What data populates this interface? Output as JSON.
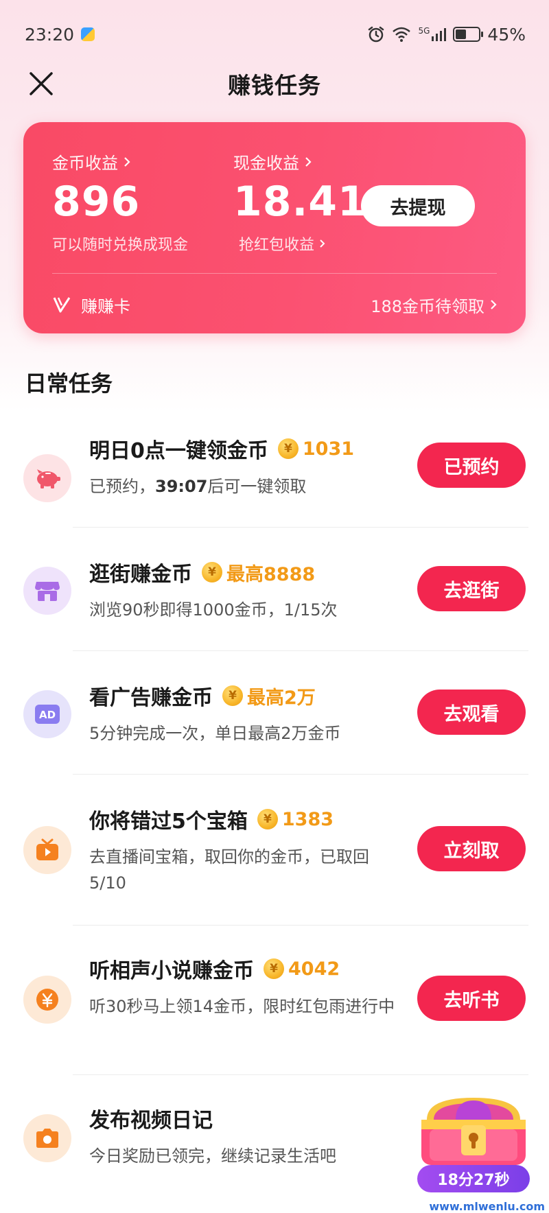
{
  "status_bar": {
    "time": "23:20",
    "network": "5G",
    "battery_percent": "45%",
    "battery_level": 0.45
  },
  "header": {
    "title": "赚钱任务",
    "close_icon": "close-icon"
  },
  "earnings": {
    "coin_label": "金币收益",
    "coin_value": "896",
    "coin_sub": "可以随时兑换成现金",
    "cash_label": "现金收益",
    "cash_value": "18.41",
    "cash_sub": "抢红包收益",
    "withdraw_label": "去提现",
    "card_name": "赚赚卡",
    "card_pending": "188金币待领取",
    "colors": {
      "card_start": "#f94a65",
      "card_end": "#fd5a82"
    }
  },
  "daily": {
    "section_title": "日常任务",
    "tasks": [
      {
        "icon": "piggy-bank-icon",
        "title": "明日0点一键领金币",
        "reward": "1031",
        "desc_prefix": "已预约，",
        "desc_bold": "39:07",
        "desc_suffix": "后可一键领取",
        "button": "已预约"
      },
      {
        "icon": "shop-icon",
        "title": "逛街赚金币",
        "reward": "最高8888",
        "desc": "浏览90秒即得1000金币，1/15次",
        "button": "去逛街"
      },
      {
        "icon": "ad-icon",
        "title": "看广告赚金币",
        "reward": "最高2万",
        "desc": "5分钟完成一次，单日最高2万金币",
        "button": "去观看"
      },
      {
        "icon": "tv-play-icon",
        "title": "你将错过5个宝箱",
        "reward": "1383",
        "desc": "去直播间宝箱，取回你的金币，已取回 5/10",
        "button": "立刻取"
      },
      {
        "icon": "yen-coin-icon",
        "title": "听相声小说赚金币",
        "reward": "4042",
        "desc": "听30秒马上领14金币，限时红包雨进行中",
        "button": "去听书"
      },
      {
        "icon": "camera-icon",
        "title": "发布视频日记",
        "desc": "今日奖励已领完，继续记录生活吧"
      }
    ]
  },
  "chest": {
    "icon": "treasure-chest-icon",
    "timer": "18分27秒"
  },
  "watermark": "www.mlwenlu.com",
  "colors": {
    "accent": "#f3264f",
    "reward": "#f29a17",
    "timer": "#8b44ec"
  }
}
